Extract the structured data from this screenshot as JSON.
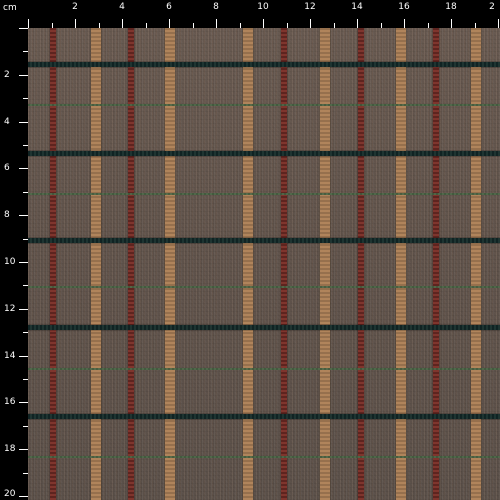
{
  "ruler": {
    "unit": "cm",
    "top_labels": [
      "2",
      "4",
      "6",
      "8",
      "10",
      "12",
      "14",
      "16",
      "18",
      "2"
    ],
    "left_labels": [
      "2",
      "4",
      "6",
      "8",
      "10",
      "12",
      "14",
      "16",
      "18",
      "20"
    ]
  }
}
